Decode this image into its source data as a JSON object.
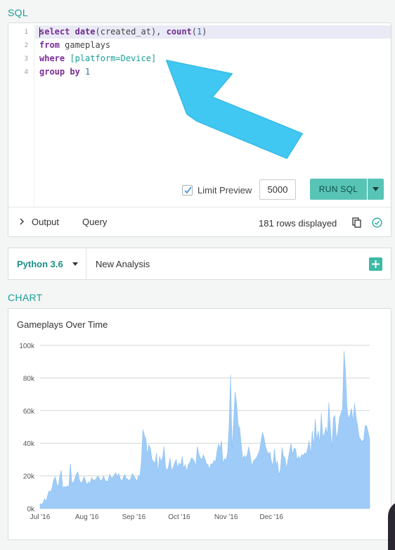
{
  "sql_section": {
    "label": "SQL",
    "line_numbers": [
      "1",
      "2",
      "3",
      "4"
    ],
    "code": {
      "l1": {
        "kw_select": "select",
        "fn_date": "date",
        "plain1": "(created_at), ",
        "fn_count": "count",
        "plain2": "(",
        "num1": "1",
        "plain3": ")"
      },
      "l2": {
        "kw_from": "from",
        "plain": " gameplays"
      },
      "l3": {
        "kw_where": "where",
        "plain": " ",
        "param": "[platform=Device]"
      },
      "l4": {
        "kw_group": "group by",
        "plain": " ",
        "num": "1"
      }
    },
    "limit_preview": {
      "label": "Limit Preview",
      "checked": true,
      "value": "5000"
    },
    "run_button": "RUN SQL",
    "tabs": {
      "output": "Output",
      "query": "Query"
    },
    "rows_displayed": "181 rows displayed"
  },
  "python_bar": {
    "version": "Python 3.6",
    "analysis_name": "New Analysis"
  },
  "chart_section": {
    "label": "CHART"
  },
  "colors": {
    "accent": "#1aa095",
    "run_button": "#58c4b6",
    "area_fill": "#9ecbf7",
    "annotation_arrow": "#41c8f2"
  },
  "chart_data": {
    "type": "area",
    "title": "Gameplays Over Time",
    "xlabel": "",
    "ylabel": "",
    "ylim": [
      0,
      100000
    ],
    "yticks": [
      0,
      20000,
      40000,
      60000,
      80000,
      100000
    ],
    "yticklabels": [
      "0k",
      "20k",
      "40k",
      "60k",
      "80k",
      "100k"
    ],
    "xticks": [
      "Jul '16",
      "Aug '16",
      "Sep '16",
      "Oct '16",
      "Nov '16",
      "Dec '16"
    ],
    "grid": true,
    "x_start": "2016-07-01",
    "series": [
      {
        "values": [
          3000,
          2500,
          3500,
          6000,
          4500,
          8000,
          11000,
          10000,
          13000,
          17500,
          19500,
          15500,
          13000,
          19500,
          23500,
          12500,
          13500,
          13000,
          14000,
          13000,
          27500,
          16500,
          15500,
          18500,
          21000,
          22500,
          17500,
          15500,
          16500,
          19500,
          17500,
          14500,
          16500,
          15000,
          19000,
          17500,
          17500,
          18000,
          20000,
          19000,
          17000,
          17500,
          20000,
          17500,
          16500,
          17000,
          21000,
          19000,
          19000,
          20500,
          22000,
          19500,
          21500,
          18500,
          16500,
          19000,
          21000,
          18500,
          18000,
          17000,
          18500,
          21500,
          20000,
          18500,
          16500,
          20000,
          20000,
          29000,
          48500,
          45000,
          42500,
          33000,
          39000,
          37000,
          30000,
          29000,
          27500,
          34000,
          22000,
          32000,
          29000,
          31000,
          38000,
          25500,
          23000,
          26000,
          31000,
          23500,
          25000,
          28000,
          30000,
          25000,
          28000,
          26500,
          32000,
          24500,
          27000,
          22500,
          27000,
          28000,
          31000,
          30500,
          29000,
          26000,
          38000,
          33500,
          31000,
          30000,
          33000,
          30500,
          27500,
          27000,
          24000,
          27500,
          27000,
          29500,
          28500,
          35000,
          39500,
          37000,
          41500,
          27500,
          30500,
          30000,
          34000,
          50500,
          82000,
          36500,
          53500,
          71500,
          64500,
          51000,
          49500,
          40000,
          30000,
          32500,
          31000,
          33000,
          38000,
          32500,
          26000,
          29000,
          30000,
          31000,
          33000,
          35000,
          40500,
          46500,
          44000,
          38500,
          35500,
          33500,
          34500,
          29000,
          26000,
          36500,
          27000,
          29000,
          20500,
          24000,
          37500,
          32000,
          31000,
          24500,
          30000,
          35000,
          40000,
          33000,
          37000,
          36500,
          30000,
          32000,
          30500,
          33000,
          32500,
          34000,
          33500,
          37000,
          41500,
          33000,
          47500,
          38000,
          55000,
          42000,
          47500,
          40000,
          58500,
          44000,
          45500,
          50000,
          45500,
          65000,
          49500,
          37000,
          55500,
          57000,
          42500,
          47000,
          55500,
          58500,
          61000,
          96500,
          84500,
          61500,
          55000,
          57500,
          61500,
          53500,
          64500,
          56000,
          51000,
          44000,
          42500,
          41000,
          42000,
          51000,
          50500,
          47000,
          42000
        ]
      }
    ]
  }
}
